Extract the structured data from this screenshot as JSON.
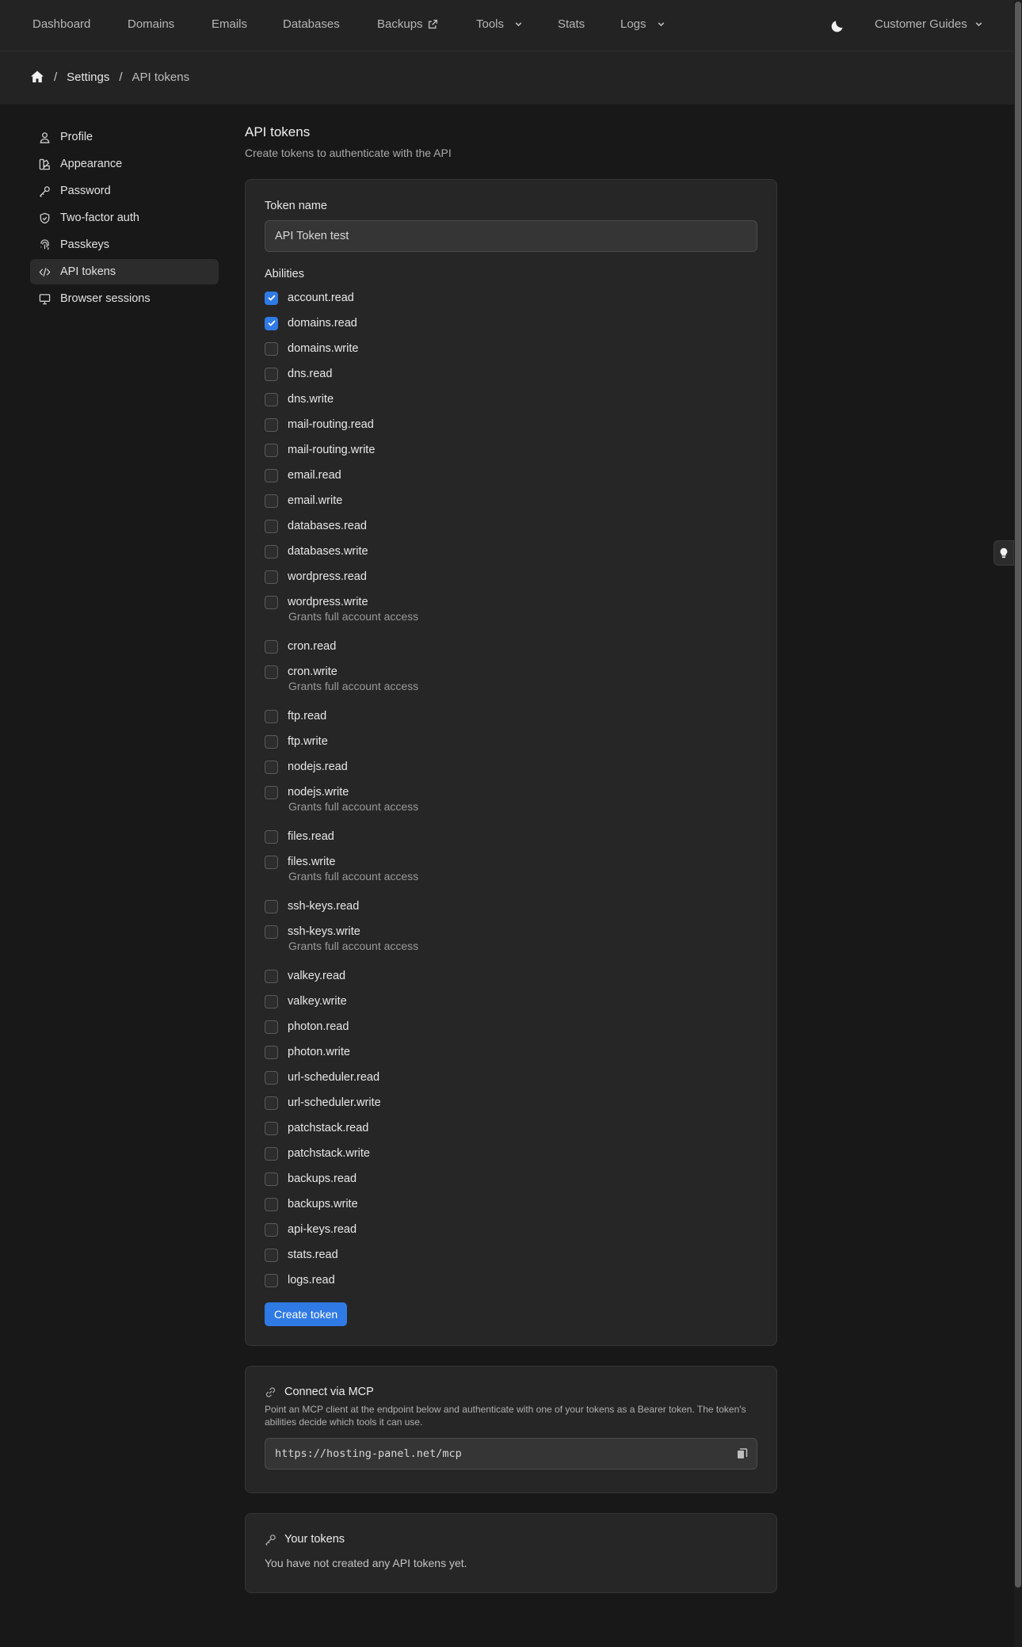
{
  "nav": {
    "items": [
      {
        "label": "Dashboard",
        "icon": ""
      },
      {
        "label": "Domains",
        "icon": ""
      },
      {
        "label": "Emails",
        "icon": ""
      },
      {
        "label": "Databases",
        "icon": ""
      },
      {
        "label": "Backups",
        "icon": "external-link-icon"
      },
      {
        "label": "Tools",
        "icon": "chevron-down-icon"
      },
      {
        "label": "Stats",
        "icon": ""
      },
      {
        "label": "Logs",
        "icon": "chevron-down-icon"
      }
    ],
    "theme_icon": "moon-icon",
    "guides_label": "Customer Guides"
  },
  "breadcrumb": {
    "home_icon": "home-icon",
    "settings": "Settings",
    "current": "API tokens"
  },
  "sidebar": {
    "items": [
      {
        "label": "Profile",
        "icon": "user-icon",
        "active": false
      },
      {
        "label": "Appearance",
        "icon": "palette-icon",
        "active": false
      },
      {
        "label": "Password",
        "icon": "key-icon",
        "active": false
      },
      {
        "label": "Two-factor auth",
        "icon": "shield-icon",
        "active": false
      },
      {
        "label": "Passkeys",
        "icon": "fingerprint-icon",
        "active": false
      },
      {
        "label": "API tokens",
        "icon": "code-icon",
        "active": true
      },
      {
        "label": "Browser sessions",
        "icon": "monitor-icon",
        "active": false
      }
    ]
  },
  "main": {
    "title": "API tokens",
    "subtitle": "Create tokens to authenticate with the API",
    "form": {
      "token_name_label": "Token name",
      "token_name_value": "API Token test",
      "abilities_label": "Abilities",
      "abilities": [
        {
          "name": "account.read",
          "checked": true,
          "note": ""
        },
        {
          "name": "domains.read",
          "checked": true,
          "note": ""
        },
        {
          "name": "domains.write",
          "checked": false,
          "note": ""
        },
        {
          "name": "dns.read",
          "checked": false,
          "note": ""
        },
        {
          "name": "dns.write",
          "checked": false,
          "note": ""
        },
        {
          "name": "mail-routing.read",
          "checked": false,
          "note": ""
        },
        {
          "name": "mail-routing.write",
          "checked": false,
          "note": ""
        },
        {
          "name": "email.read",
          "checked": false,
          "note": ""
        },
        {
          "name": "email.write",
          "checked": false,
          "note": ""
        },
        {
          "name": "databases.read",
          "checked": false,
          "note": ""
        },
        {
          "name": "databases.write",
          "checked": false,
          "note": ""
        },
        {
          "name": "wordpress.read",
          "checked": false,
          "note": ""
        },
        {
          "name": "wordpress.write",
          "checked": false,
          "note": "Grants full account access"
        },
        {
          "name": "cron.read",
          "checked": false,
          "note": ""
        },
        {
          "name": "cron.write",
          "checked": false,
          "note": "Grants full account access"
        },
        {
          "name": "ftp.read",
          "checked": false,
          "note": ""
        },
        {
          "name": "ftp.write",
          "checked": false,
          "note": ""
        },
        {
          "name": "nodejs.read",
          "checked": false,
          "note": ""
        },
        {
          "name": "nodejs.write",
          "checked": false,
          "note": "Grants full account access"
        },
        {
          "name": "files.read",
          "checked": false,
          "note": ""
        },
        {
          "name": "files.write",
          "checked": false,
          "note": "Grants full account access"
        },
        {
          "name": "ssh-keys.read",
          "checked": false,
          "note": ""
        },
        {
          "name": "ssh-keys.write",
          "checked": false,
          "note": "Grants full account access"
        },
        {
          "name": "valkey.read",
          "checked": false,
          "note": ""
        },
        {
          "name": "valkey.write",
          "checked": false,
          "note": ""
        },
        {
          "name": "photon.read",
          "checked": false,
          "note": ""
        },
        {
          "name": "photon.write",
          "checked": false,
          "note": ""
        },
        {
          "name": "url-scheduler.read",
          "checked": false,
          "note": ""
        },
        {
          "name": "url-scheduler.write",
          "checked": false,
          "note": ""
        },
        {
          "name": "patchstack.read",
          "checked": false,
          "note": ""
        },
        {
          "name": "patchstack.write",
          "checked": false,
          "note": ""
        },
        {
          "name": "backups.read",
          "checked": false,
          "note": ""
        },
        {
          "name": "backups.write",
          "checked": false,
          "note": ""
        },
        {
          "name": "api-keys.read",
          "checked": false,
          "note": ""
        },
        {
          "name": "stats.read",
          "checked": false,
          "note": ""
        },
        {
          "name": "logs.read",
          "checked": false,
          "note": ""
        }
      ],
      "create_button": "Create token"
    },
    "mcp": {
      "title": "Connect via MCP",
      "icon": "link-icon",
      "description": "Point an MCP client at the endpoint below and authenticate with one of your tokens as a Bearer token. The token's abilities decide which tools it can use.",
      "endpoint": "https://hosting-panel.net/mcp",
      "copy_icon": "copy-icon"
    },
    "tokens": {
      "title": "Your tokens",
      "icon": "key-icon",
      "empty_text": "You have not created any API tokens yet."
    }
  },
  "colors": {
    "accent": "#2f7ae5",
    "background": "#181818",
    "card": "#262626"
  }
}
